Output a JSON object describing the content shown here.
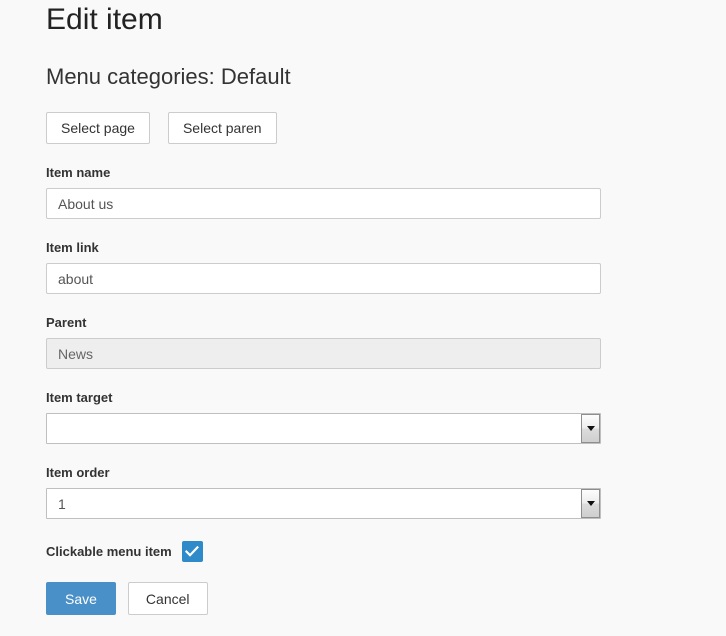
{
  "header": {
    "title": "Edit item",
    "subtitle": "Menu categories: Default"
  },
  "toolbar": {
    "select_page_label": "Select page",
    "select_parent_label": "Select paren"
  },
  "form": {
    "item_name": {
      "label": "Item name",
      "value": "About us",
      "placeholder": ""
    },
    "item_link": {
      "label": "Item link",
      "value": "about",
      "placeholder": ""
    },
    "parent": {
      "label": "Parent",
      "value": "News",
      "placeholder": ""
    },
    "item_target": {
      "label": "Item target",
      "value": ""
    },
    "item_order": {
      "label": "Item order",
      "value": "1"
    },
    "clickable_menu_item": {
      "label": "Clickable menu item",
      "checked": true
    }
  },
  "footer": {
    "save_label": "Save",
    "cancel_label": "Cancel"
  },
  "colors": {
    "accent": "#4a90c8",
    "checkbox": "#2e8ac9",
    "background": "#f9f9f9",
    "border": "#cccccc"
  }
}
